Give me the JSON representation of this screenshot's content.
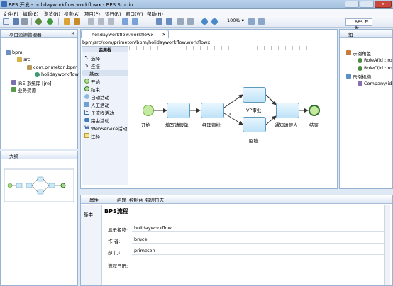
{
  "window": {
    "title": "BPS 开发 - holidayworkflow.workflowx - BPS Studio"
  },
  "menu": [
    "文件(F)",
    "编辑(E)",
    "浏览(N)",
    "搜索(A)",
    "项目(P)",
    "运行(R)",
    "窗口(W)",
    "帮助(H)"
  ],
  "toolbar": {
    "zoom": "100%",
    "perspective": "BPS 开发"
  },
  "project_explorer": {
    "title": "项目资源管理器",
    "items": [
      "bpm",
      "src",
      "com.primeton.bpm",
      "holidayworkflow",
      "JRE 系统库 [jre]",
      "业务资源"
    ]
  },
  "outline": {
    "title": "大纲"
  },
  "editor": {
    "tab": "holidayworkflow.workflowx",
    "path": "bpm/src/com/primeton/bpm/holidayworkflow.workflowx",
    "palette": {
      "header": "选用板",
      "top_items": [
        "选择",
        "连接"
      ],
      "group": "基本",
      "items": [
        "开始",
        "结束",
        "自动活动",
        "人工活动",
        "子流程活动",
        "路由活动",
        "WebService活动",
        "注释"
      ]
    },
    "diagram": {
      "start": "开始",
      "fill_form": "填写请假单",
      "manager_approve": "经理审批",
      "vp_approve": "VP审批",
      "notify": "通知请假人",
      "reject": "回档",
      "end": "结束"
    }
  },
  "right_panel": {
    "tab": "组",
    "items": [
      "示例角色",
      "RoleA(id : ro",
      "RoleC(id : ro",
      "示例机构",
      "Company(id"
    ]
  },
  "bottom": {
    "tabs": [
      "属性",
      "问题",
      "控制台",
      "错误日志"
    ],
    "side_tab": "基本",
    "header": "BPS流程",
    "fields": [
      {
        "label": "显示名称:",
        "value": "holidayworkflow"
      },
      {
        "label": "作    者:",
        "value": "bruce"
      },
      {
        "label": "部    门:",
        "value": "primeton"
      },
      {
        "label": "流程日历:",
        "value": ""
      }
    ]
  }
}
